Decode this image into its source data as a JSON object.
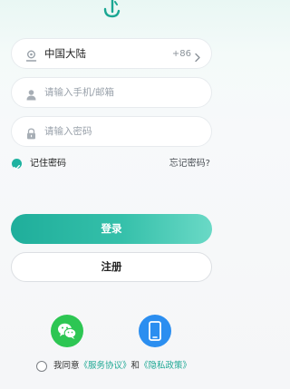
{
  "region": {
    "value": "中国大陆",
    "code": "+86"
  },
  "account": {
    "placeholder": "请输入手机/邮箱"
  },
  "password": {
    "placeholder": "请输入密码"
  },
  "remember": {
    "label": "记住密码",
    "checked": true
  },
  "forgot_label": "忘记密码?",
  "login_label": "登录",
  "register_label": "注册",
  "social": {
    "wechat_icon": "wechat-icon",
    "phone_icon": "phone-icon"
  },
  "agreement": {
    "prefix": "我同意",
    "service_link": "《服务协议》",
    "and": "和",
    "privacy_link": "《隐私政策》"
  },
  "colors": {
    "accent": "#1fb2a0",
    "wechat": "#2dc653",
    "phone": "#2b8ef0"
  }
}
